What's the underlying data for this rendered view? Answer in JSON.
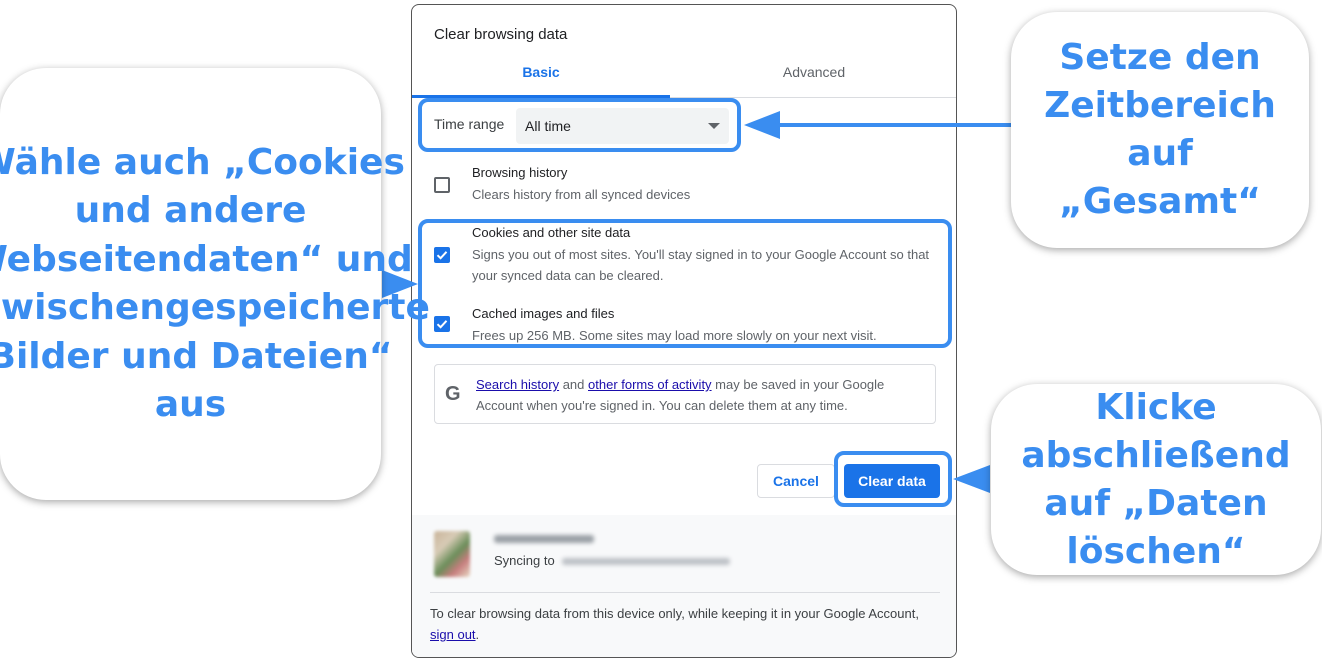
{
  "dialog": {
    "title": "Clear browsing data",
    "tabs": [
      {
        "label": "Basic",
        "active": true
      },
      {
        "label": "Advanced",
        "active": false
      }
    ],
    "time_range": {
      "label": "Time range",
      "value": "All time"
    },
    "items": [
      {
        "title": "Browsing history",
        "description": "Clears history from all synced devices",
        "checked": false
      },
      {
        "title": "Cookies and other site data",
        "description": "Signs you out of most sites. You'll stay signed in to your Google Account so that your synced data can be cleared.",
        "checked": true
      },
      {
        "title": "Cached images and files",
        "description": "Frees up 256 MB. Some sites may load more slowly on your next visit.",
        "checked": true
      }
    ],
    "google_notice": {
      "icon": "google-g-icon",
      "icon_glyph": "G",
      "link1": "Search history",
      "and": " and ",
      "link2": "other forms of activity",
      "rest": " may be saved in your Google Account when you're signed in. You can delete them at any time."
    },
    "buttons": {
      "cancel": "Cancel",
      "clear": "Clear data"
    },
    "account": {
      "sync_label": "Syncing to"
    },
    "footer": {
      "text": "To clear browsing data from this device only, while keeping it in your Google Account, ",
      "link": "sign out",
      "end": "."
    }
  },
  "callouts": {
    "left": "Wähle auch „Cookies und andere Webseitendaten“ und „Zwischengespeicherte Bilder und Dateien“ aus",
    "right_top": "Setze den Zeitbereich auf „Gesamt“",
    "right_bottom": "Klicke abschließend auf „Daten löschen“"
  },
  "colors": {
    "accent": "#1a73e8",
    "highlight": "#3a8df0"
  }
}
